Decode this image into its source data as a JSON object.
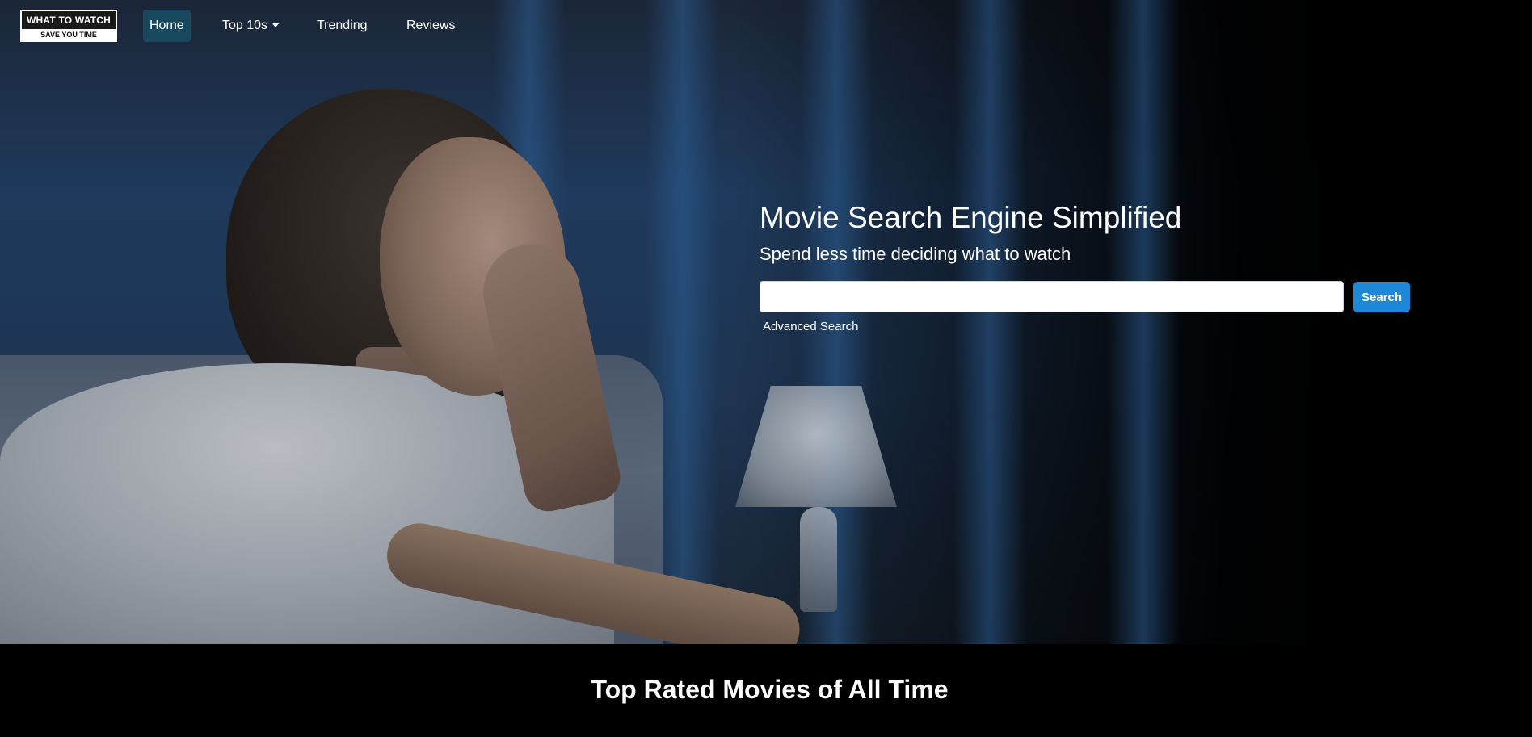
{
  "brand": {
    "logo_top": "WHAT TO WATCH",
    "logo_bottom": "SAVE YOU TIME"
  },
  "nav": {
    "home": "Home",
    "top10": "Top 10s",
    "trending": "Trending",
    "reviews": "Reviews",
    "active": "Home"
  },
  "hero": {
    "title": "Movie Search Engine Simplified",
    "subtitle": "Spend less time deciding what to watch",
    "search_value": "",
    "search_button": "Search",
    "advanced_link": "Advanced Search"
  },
  "section": {
    "title": "Top Rated Movies of All Time"
  },
  "colors": {
    "nav_active_bg": "#17485e",
    "search_button_bg": "#1e88d8",
    "page_bg": "#000000"
  },
  "icons": {
    "dropdown": "caret-down-icon"
  }
}
